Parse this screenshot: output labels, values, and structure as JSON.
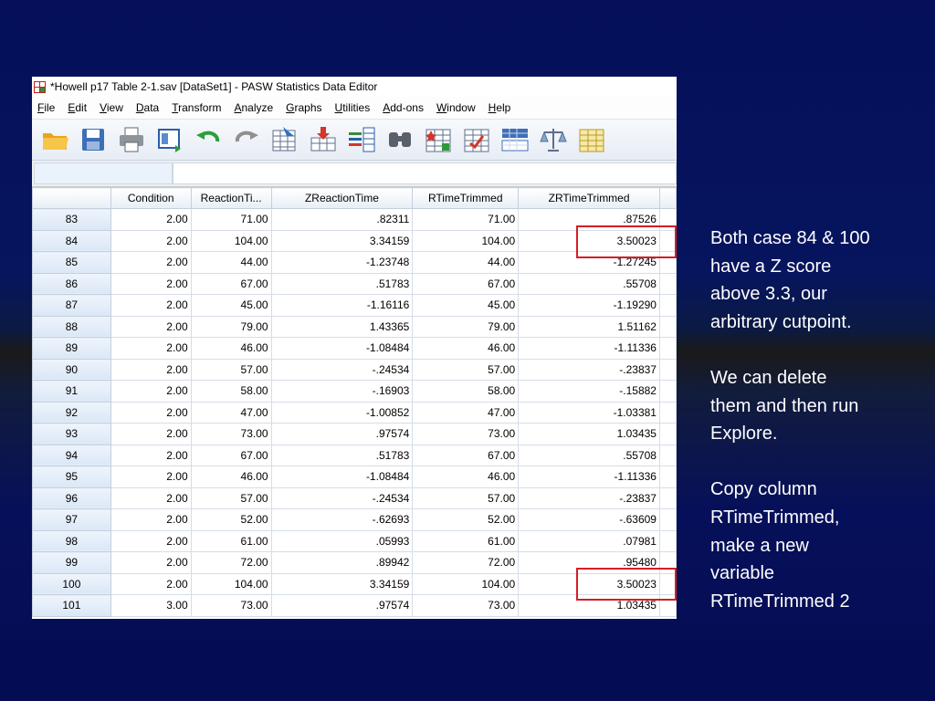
{
  "window": {
    "title": "*Howell p17 Table 2-1.sav [DataSet1] - PASW Statistics Data Editor"
  },
  "menu": [
    "File",
    "Edit",
    "View",
    "Data",
    "Transform",
    "Analyze",
    "Graphs",
    "Utilities",
    "Add-ons",
    "Window",
    "Help"
  ],
  "toolbar_icons": [
    "open-folder-icon",
    "save-icon",
    "print-icon",
    "dialog-recall-icon",
    "undo-icon",
    "redo-icon",
    "goto-case-icon",
    "goto-variable-icon",
    "variables-icon",
    "find-icon",
    "insert-cases-icon",
    "insert-variable-icon",
    "split-file-icon",
    "weight-cases-icon",
    "select-cases-icon"
  ],
  "grid": {
    "columns": [
      "Condition",
      "ReactionTi...",
      "ZReactionTime",
      "RTimeTrimmed",
      "ZRTimeTrimmed"
    ],
    "rows": [
      {
        "case": "83",
        "values": [
          "2.00",
          "71.00",
          ".82311",
          "71.00",
          ".87526"
        ]
      },
      {
        "case": "84",
        "values": [
          "2.00",
          "104.00",
          "3.34159",
          "104.00",
          "3.50023"
        ]
      },
      {
        "case": "85",
        "values": [
          "2.00",
          "44.00",
          "-1.23748",
          "44.00",
          "-1.27245"
        ]
      },
      {
        "case": "86",
        "values": [
          "2.00",
          "67.00",
          ".51783",
          "67.00",
          ".55708"
        ]
      },
      {
        "case": "87",
        "values": [
          "2.00",
          "45.00",
          "-1.16116",
          "45.00",
          "-1.19290"
        ]
      },
      {
        "case": "88",
        "values": [
          "2.00",
          "79.00",
          "1.43365",
          "79.00",
          "1.51162"
        ]
      },
      {
        "case": "89",
        "values": [
          "2.00",
          "46.00",
          "-1.08484",
          "46.00",
          "-1.11336"
        ]
      },
      {
        "case": "90",
        "values": [
          "2.00",
          "57.00",
          "-.24534",
          "57.00",
          "-.23837"
        ]
      },
      {
        "case": "91",
        "values": [
          "2.00",
          "58.00",
          "-.16903",
          "58.00",
          "-.15882"
        ]
      },
      {
        "case": "92",
        "values": [
          "2.00",
          "47.00",
          "-1.00852",
          "47.00",
          "-1.03381"
        ]
      },
      {
        "case": "93",
        "values": [
          "2.00",
          "73.00",
          ".97574",
          "73.00",
          "1.03435"
        ]
      },
      {
        "case": "94",
        "values": [
          "2.00",
          "67.00",
          ".51783",
          "67.00",
          ".55708"
        ]
      },
      {
        "case": "95",
        "values": [
          "2.00",
          "46.00",
          "-1.08484",
          "46.00",
          "-1.11336"
        ]
      },
      {
        "case": "96",
        "values": [
          "2.00",
          "57.00",
          "-.24534",
          "57.00",
          "-.23837"
        ]
      },
      {
        "case": "97",
        "values": [
          "2.00",
          "52.00",
          "-.62693",
          "52.00",
          "-.63609"
        ]
      },
      {
        "case": "98",
        "values": [
          "2.00",
          "61.00",
          ".05993",
          "61.00",
          ".07981"
        ]
      },
      {
        "case": "99",
        "values": [
          "2.00",
          "72.00",
          ".89942",
          "72.00",
          ".95480"
        ]
      },
      {
        "case": "100",
        "values": [
          "2.00",
          "104.00",
          "3.34159",
          "104.00",
          "3.50023"
        ]
      },
      {
        "case": "101",
        "values": [
          "3.00",
          "73.00",
          ".97574",
          "73.00",
          "1.03435"
        ]
      }
    ]
  },
  "annotation": {
    "paragraphs": [
      "Both case 84 & 100 have a Z score above 3.3, our arbitrary cutpoint.",
      "We can delete them and then run Explore.",
      "Copy column RTimeTrimmed, make a new variable RTimeTrimmed 2"
    ],
    "highlight_color": "#d21f26"
  }
}
